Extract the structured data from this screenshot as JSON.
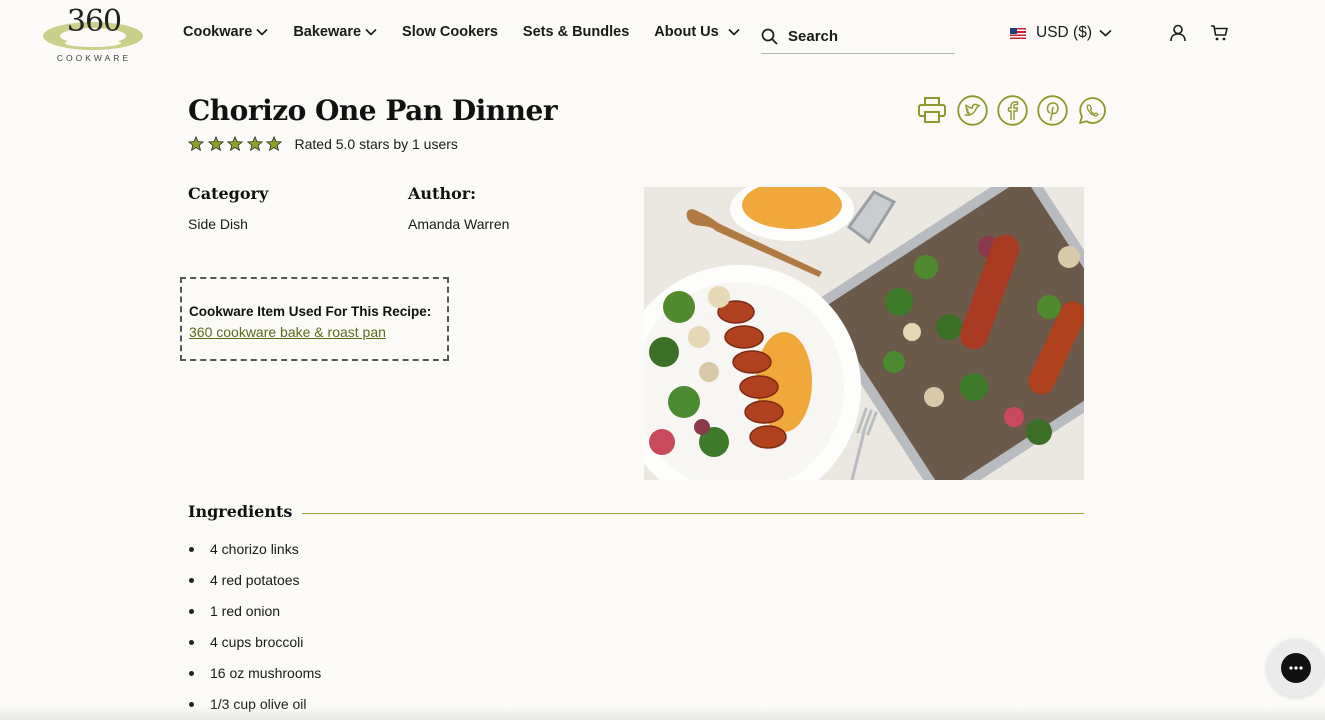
{
  "header": {
    "logo": {
      "number": "360",
      "word": "COOKWARE"
    },
    "nav": [
      {
        "label": "Cookware",
        "has_dropdown": true
      },
      {
        "label": "Bakeware",
        "has_dropdown": true
      },
      {
        "label": "Slow Cookers",
        "has_dropdown": false
      },
      {
        "label": "Sets & Bundles",
        "has_dropdown": false
      },
      {
        "label": "About Us",
        "has_dropdown": true
      }
    ],
    "search": {
      "placeholder": "Search",
      "icon": "search-icon"
    },
    "currency": {
      "label": "USD ($)",
      "flag": "us-flag-icon"
    },
    "icons": [
      "user-icon",
      "cart-icon"
    ]
  },
  "recipe": {
    "title": "Chorizo One Pan Dinner",
    "rating": {
      "stars": 5,
      "text": "Rated 5.0 stars by 1 users"
    },
    "share_icons": [
      "print-icon",
      "twitter-icon",
      "facebook-icon",
      "pinterest-icon",
      "whatsapp-icon"
    ],
    "category_label": "Category",
    "category_value": "Side Dish",
    "author_label": "Author:",
    "author_value": "Amanda Warren",
    "cookware_title": "Cookware Item Used For This Recipe:",
    "cookware_link": "360 cookware bake & roast pan",
    "ingredients_title": "Ingredients",
    "ingredients": [
      "4 chorizo links",
      "4 red potatoes",
      "1 red onion",
      "4 cups broccoli",
      "16 oz mushrooms",
      "1/3 cup olive oil"
    ]
  },
  "colors": {
    "accent": "#8b9a2c",
    "star": "#8ca12a",
    "link": "#5a6a1a",
    "background": "#fbfaf7"
  },
  "chat_icon": "chat-bubble-icon"
}
